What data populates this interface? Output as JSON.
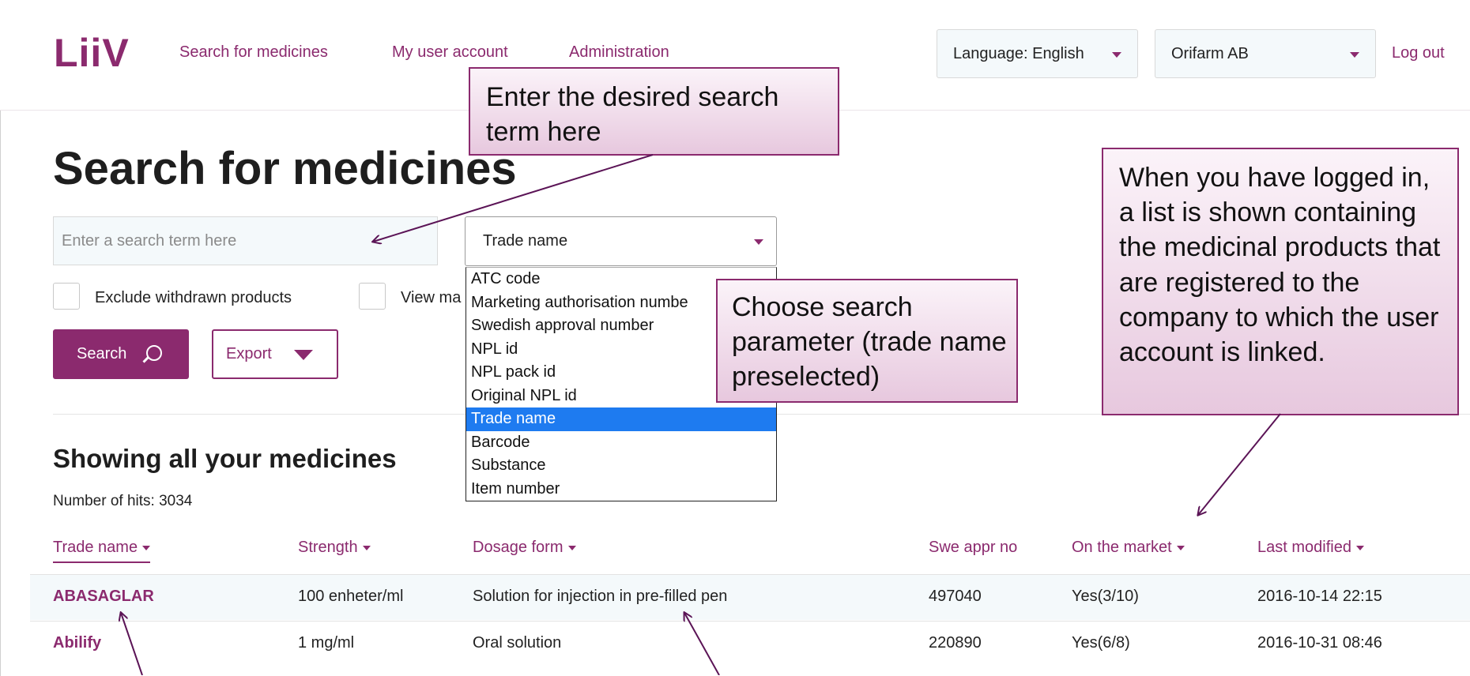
{
  "header": {
    "logo": "LiiV",
    "nav": [
      "Search for medicines",
      "My user account",
      "Administration"
    ],
    "language_select": "Language: English",
    "company_select": "Orifarm AB",
    "logout": "Log out"
  },
  "search": {
    "title": "Search for medicines",
    "input_placeholder": "Enter a search term here",
    "parameter_selected": "Trade name",
    "parameter_options": [
      "ATC code",
      "Marketing authorisation numbe",
      "Swedish approval number",
      "NPL id",
      "NPL pack id",
      "Original NPL id",
      "Trade name",
      "Barcode",
      "Substance",
      "Item number"
    ],
    "exclude_withdrawn_label": "Exclude withdrawn products",
    "view_label": "View ma",
    "search_button": "Search",
    "export_button": "Export"
  },
  "results": {
    "title": "Showing all your medicines",
    "hits": "Number of hits: 3034",
    "columns": [
      "Trade name",
      "Strength",
      "Dosage form",
      "Swe appr no",
      "On the market",
      "Last modified"
    ],
    "rows": [
      [
        "ABASAGLAR",
        "100 enheter/ml",
        "Solution for injection in pre-filled pen",
        "497040",
        "Yes(3/10)",
        "2016-10-14 22:15"
      ],
      [
        "Abilify",
        "1 mg/ml",
        "Oral solution",
        "220890",
        "Yes(6/8)",
        "2016-10-31 08:46"
      ]
    ]
  },
  "callouts": {
    "search_term": "Enter the desired search term here",
    "parameter": "Choose search parameter (trade name preselected)",
    "list_info": "When you have logged in, a list is shown containing the medicinal products that are registered to the company to which the user account is linked."
  },
  "colors": {
    "brand": "#8b2a6e",
    "selection": "#1e7bf0",
    "input_bg": "#f4f9fb"
  }
}
